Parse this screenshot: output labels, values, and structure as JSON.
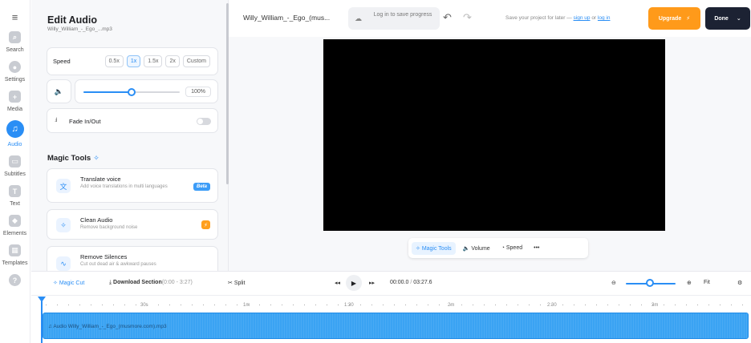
{
  "rail": {
    "menu_icon": "hamburger-icon",
    "items": [
      {
        "label": "Search",
        "icon": "search-icon"
      },
      {
        "label": "Settings",
        "icon": "gear-icon"
      },
      {
        "label": "Media",
        "icon": "plus-icon"
      },
      {
        "label": "Audio",
        "icon": "music-note-icon",
        "active": true
      },
      {
        "label": "Subtitles",
        "icon": "subtitles-icon"
      },
      {
        "label": "Text",
        "icon": "text-icon"
      },
      {
        "label": "Elements",
        "icon": "elements-icon"
      },
      {
        "label": "Templates",
        "icon": "templates-icon"
      },
      {
        "label": "",
        "icon": "help-icon"
      }
    ]
  },
  "panel": {
    "title": "Edit Audio",
    "filename": "Willy_William_-_Ego_...mp3",
    "speed_label": "Speed",
    "speed_options": [
      "0.5x",
      "1x",
      "1.5x",
      "2x",
      "Custom"
    ],
    "speed_selected": "1x",
    "volume_icon": "speaker-icon",
    "volume_value": 0.5,
    "volume_percent": "100%",
    "fade_label": "Fade In/Out",
    "fade_on": false,
    "magic_title": "Magic Tools",
    "tools": [
      {
        "title": "Translate voice",
        "desc": "Add voice translations in multi languages",
        "badge": "Beta",
        "icon": "translate-icon"
      },
      {
        "title": "Clean Audio",
        "desc": "Remove background noise",
        "badge": "",
        "icon": "sparkle-icon"
      },
      {
        "title": "Remove Silences",
        "desc": "Cut out dead air & awkward pauses",
        "badge": "",
        "icon": "waveform-icon"
      }
    ]
  },
  "header": {
    "project_name": "Willy_William_-_Ego_(mus...",
    "login_text": "Log in to save progress",
    "save_note_prefix": "Save your project for later — ",
    "sign_up": "sign up",
    "or": " or ",
    "log_in": "log in",
    "upgrade": "Upgrade",
    "done": "Done"
  },
  "mini_toolbar": {
    "magic_tools": "Magic Tools",
    "volume": "Volume",
    "speed": "Speed",
    "more": "•••"
  },
  "timeline": {
    "magic_cut": "Magic Cut",
    "download": "Download Section",
    "download_range": "(0:00 - 3:27)",
    "split": "Split",
    "current_time": "00:00.0",
    "separator": "/",
    "total_time": "03:27.6",
    "fit": "Fit",
    "zoom_value": 0.5,
    "ruler_labels": [
      "30s",
      "1m",
      "1:30",
      "2m",
      "2:30",
      "3m"
    ],
    "track_label": "Audio Willy_William_-_Ego_(musmore.com).mp3"
  },
  "colors": {
    "accent": "#2a8ef5",
    "upgrade": "#ff9a1a",
    "done": "#1c2233",
    "track": "#3aa3f3"
  }
}
